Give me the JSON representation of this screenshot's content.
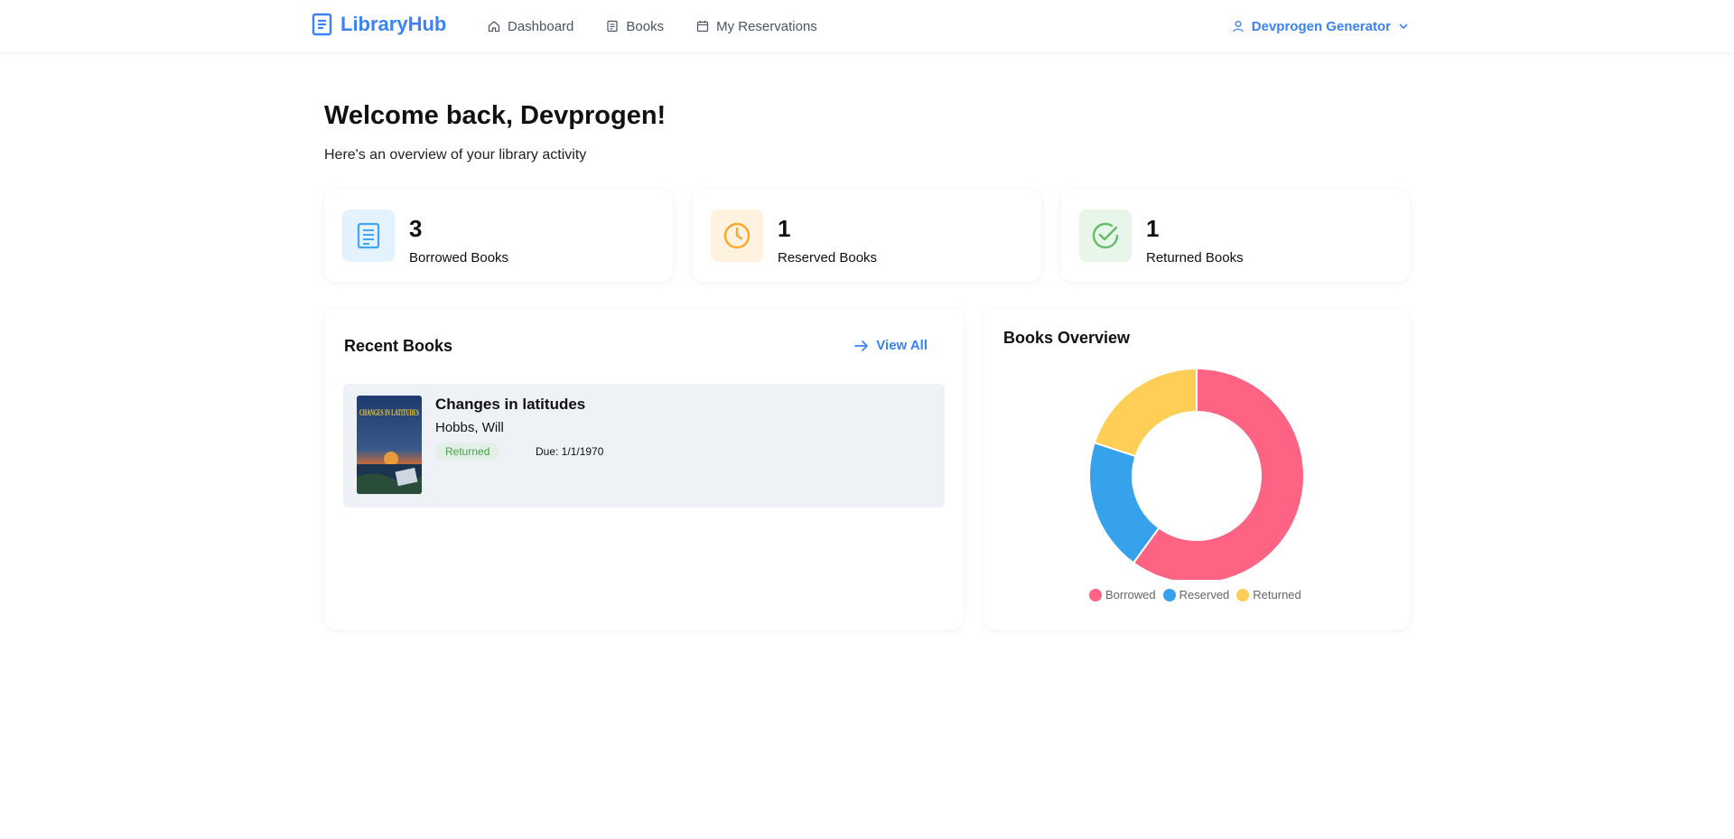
{
  "header": {
    "logo_text": "LibraryHub",
    "nav": [
      {
        "label": "Dashboard",
        "icon": "home-icon"
      },
      {
        "label": "Books",
        "icon": "book-icon"
      },
      {
        "label": "My Reservations",
        "icon": "calendar-icon"
      }
    ],
    "user_name": "Devprogen Generator"
  },
  "welcome": {
    "title": "Welcome back, Devprogen!",
    "subtitle": "Here's an overview of your library activity"
  },
  "stats": [
    {
      "value": "3",
      "label": "Borrowed Books",
      "icon": "book-icon",
      "color": "#42a5f5",
      "bg": "#e3f2fd"
    },
    {
      "value": "1",
      "label": "Reserved Books",
      "icon": "clock-icon",
      "color": "#ffa726",
      "bg": "#fff3e0"
    },
    {
      "value": "1",
      "label": "Returned Books",
      "icon": "check-circle-icon",
      "color": "#66bb6a",
      "bg": "#e8f5e9"
    }
  ],
  "recent_books": {
    "title": "Recent Books",
    "view_all_label": "View All",
    "items": [
      {
        "title": "Changes in latitudes",
        "author": "Hobbs, Will",
        "status": "Returned",
        "due": "Due: 1/1/1970",
        "cover_text": "CHANGES IN LATITUDES"
      }
    ]
  },
  "overview": {
    "title": "Books Overview"
  },
  "chart_data": {
    "type": "pie",
    "categories": [
      "Borrowed",
      "Reserved",
      "Returned"
    ],
    "values": [
      3,
      1,
      1
    ],
    "colors": [
      "#ff6384",
      "#36a2eb",
      "#ffce56"
    ],
    "title": "Books Overview",
    "donut": true,
    "legend": "bottom"
  }
}
